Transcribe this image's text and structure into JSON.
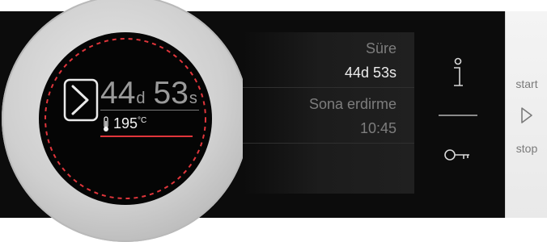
{
  "knob": {
    "time": {
      "days": "44",
      "days_unit": "d",
      "seconds": "53",
      "seconds_unit": "s"
    },
    "temperature": {
      "value": "195",
      "unit": "°C"
    }
  },
  "list": {
    "items": [
      {
        "label": "Süre",
        "value": "44d 53s"
      },
      {
        "label": "Sona erdirme",
        "value": "10:45"
      },
      {
        "label": "",
        "value": ""
      }
    ]
  },
  "side_strip": {
    "start_label": "start",
    "stop_label": "stop"
  },
  "icons": {
    "info": "info-icon",
    "key": "key-icon",
    "arrow": "chevron-right-icon",
    "play": "play-icon",
    "thermometer": "thermometer-icon"
  },
  "colors": {
    "accent": "#e0353b",
    "panel": "#0c0c0c"
  }
}
